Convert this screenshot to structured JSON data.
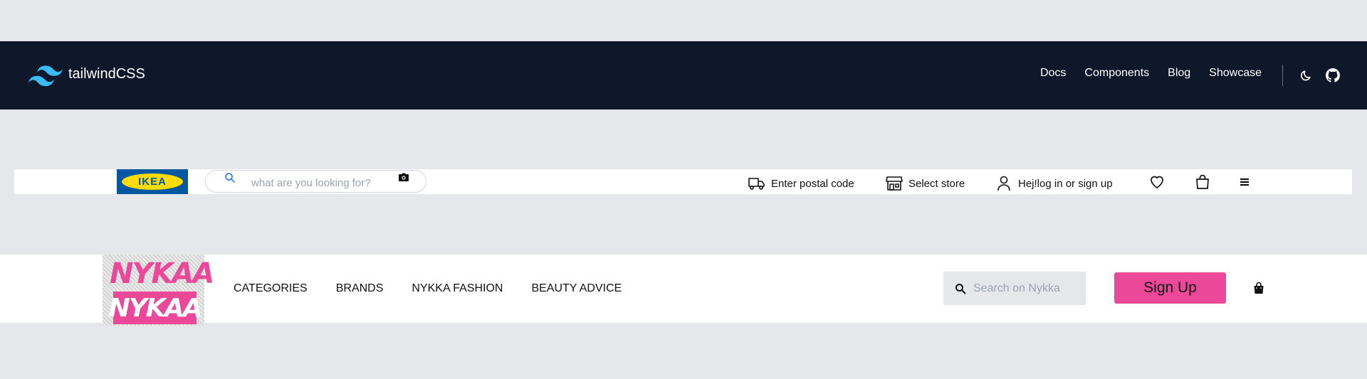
{
  "tailwind_nav": {
    "brand": "tailwindCSS",
    "links": [
      "Docs",
      "Components",
      "Blog",
      "Showcase"
    ],
    "icons": [
      "tailwind-logo-icon",
      "moon-icon",
      "github-icon"
    ]
  },
  "ikea_bar": {
    "logo_text": "IKEA",
    "search_placeholder": "what are you looking for?",
    "postal_label": "Enter postal code",
    "store_label": "Select store",
    "account_label": "Hej!log in or sign up",
    "icons": [
      "search-icon",
      "camera-icon",
      "truck-icon",
      "store-icon",
      "user-icon",
      "heart-icon",
      "bag-icon",
      "menu-icon"
    ]
  },
  "nykaa_bar": {
    "logo_text_top": "NYKAA",
    "logo_text_bottom": "NYKAA",
    "links": [
      "CATEGORIES",
      "BRANDS",
      "NYKKA FASHION",
      "BEAUTY ADVICE"
    ],
    "search_placeholder": "Search on Nykka",
    "signup_label": "Sign Up",
    "icons": [
      "search-icon",
      "shopping-bag-icon"
    ]
  },
  "colors": {
    "page_bg": "#e5e7eb",
    "tailwind_nav_bg": "#0f172a",
    "tailwind_accent": "#38bdf8",
    "ikea_blue": "#0058a3",
    "ikea_yellow": "#ffdb00",
    "nykaa_pink": "#ec4899"
  }
}
